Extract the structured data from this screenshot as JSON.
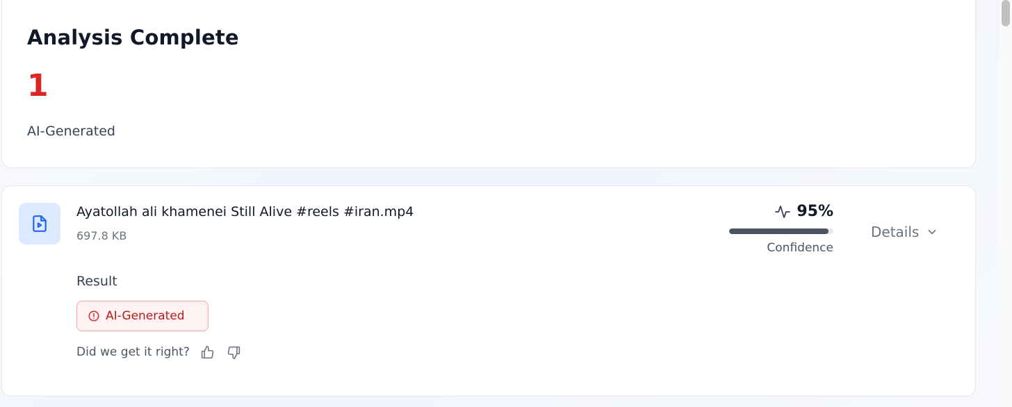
{
  "summary": {
    "title": "Analysis Complete",
    "count": "1",
    "count_label": "AI-Generated"
  },
  "file": {
    "icon": "video-file-icon",
    "name": "Ayatollah ali khamenei Still Alive #reels #iran.mp4",
    "size": "697.8 KB",
    "result_label": "Result",
    "result_badge": "AI-Generated",
    "feedback_question": "Did we get it right?",
    "confidence": {
      "value": "95%",
      "fraction": 0.95,
      "label": "Confidence"
    },
    "details_label": "Details"
  },
  "colors": {
    "ai_red": "#dc2626",
    "badge_bg": "#fef2f2",
    "icon_bg": "#dbeafe",
    "icon_blue": "#2563eb"
  }
}
